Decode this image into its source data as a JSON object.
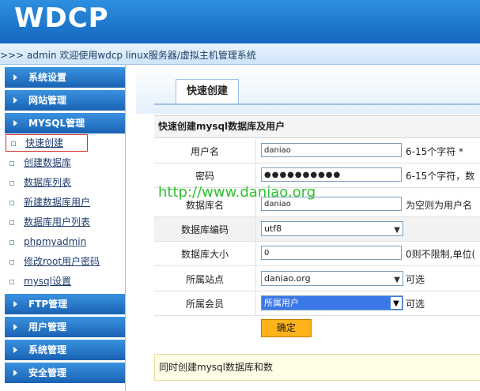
{
  "header": {
    "logo": "WDCP"
  },
  "subbar": {
    "welcome": ">>> admin 欢迎使用wdcp linux服务器/虚拟主机管理系统"
  },
  "sidebar": {
    "categories": [
      {
        "label": "系统设置"
      },
      {
        "label": "网站管理"
      },
      {
        "label": "MYSQL管理"
      },
      {
        "label": "FTP管理"
      },
      {
        "label": "用户管理"
      },
      {
        "label": "系统管理"
      },
      {
        "label": "安全管理"
      }
    ],
    "mysql_items": [
      {
        "label": "快速创建"
      },
      {
        "label": "创建数据库"
      },
      {
        "label": "数据库列表"
      },
      {
        "label": "新建数据库用户"
      },
      {
        "label": "数据库用户列表"
      },
      {
        "label": "phpmyadmin"
      },
      {
        "label": "修改root用户密码"
      },
      {
        "label": "mysql设置"
      }
    ]
  },
  "main": {
    "tab": "快速创建",
    "section_title": "快速创建mysql数据库及用户",
    "fields": {
      "username": {
        "label": "用户名",
        "value": "daniao",
        "hint": "6-15个字符 *"
      },
      "password": {
        "label": "密码",
        "value": "●●●●●●●●●●",
        "hint": "6-15个字符，数"
      },
      "dbname": {
        "label": "数据库名",
        "value": "daniao",
        "hint": "为空则为用户名"
      },
      "encoding": {
        "label": "数据库编码",
        "value": "utf8"
      },
      "dbsize": {
        "label": "数据库大小",
        "value": "0",
        "hint": "0则不限制,单位("
      },
      "site": {
        "label": "所属站点",
        "value": "daniao.org",
        "hint": "可选"
      },
      "member": {
        "label": "所属会员",
        "value": "所属用户",
        "hint": "可选"
      }
    },
    "submit_label": "确定",
    "note": "同时创建mysql数据库和数"
  },
  "watermark": "http://www.daniao.org"
}
